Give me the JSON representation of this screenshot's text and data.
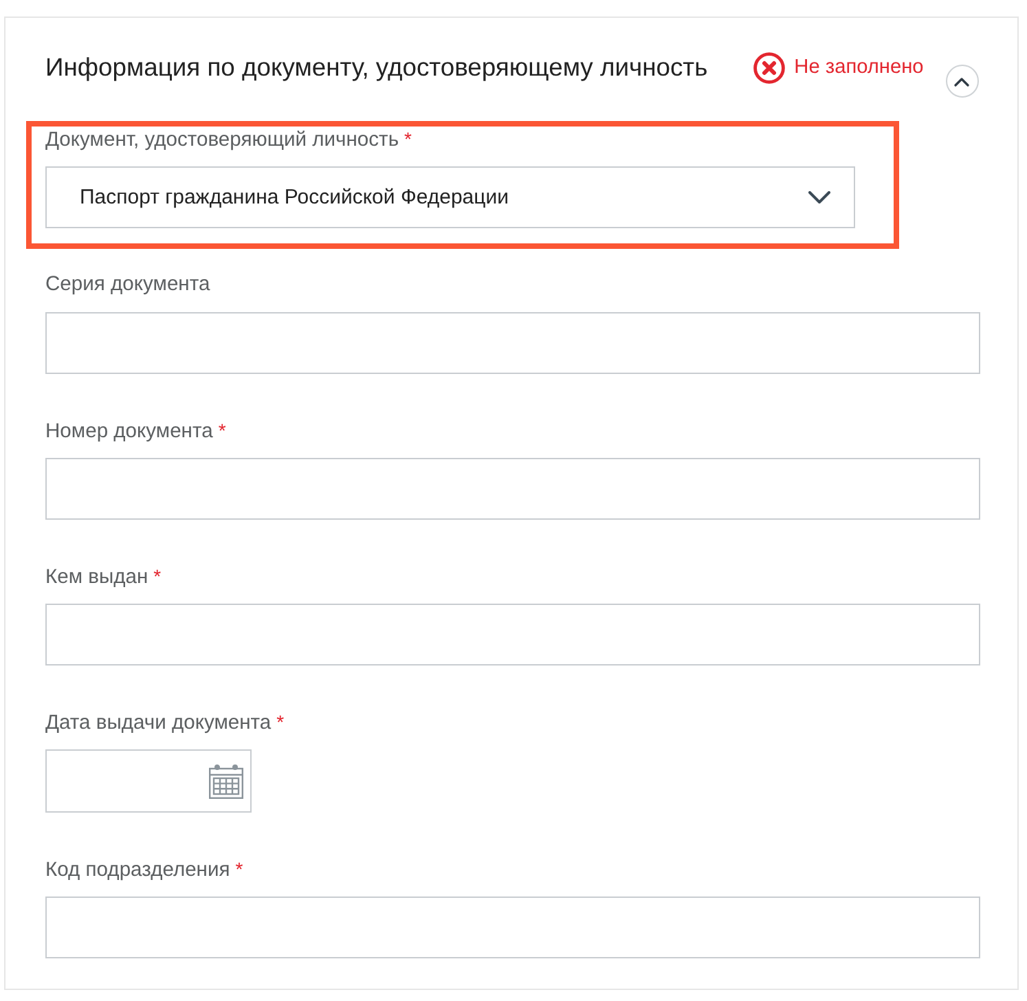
{
  "section": {
    "title": "Информация по документу, удостоверяющему личность",
    "status": {
      "kind": "error",
      "text": "Не заполнено"
    },
    "expanded": true
  },
  "fields": [
    {
      "kind": "select",
      "label": "Документ, удостоверяющий личность",
      "required_mark": "*",
      "value": "Паспорт гражданина Российской Федерации",
      "highlighted": true
    },
    {
      "kind": "text",
      "label": "Серия документа",
      "highlighted": false
    },
    {
      "kind": "text",
      "label": "Номер документа",
      "required_mark": "*",
      "highlighted": false
    },
    {
      "kind": "text",
      "label": "Кем выдан",
      "required_mark": "*",
      "highlighted": false
    },
    {
      "kind": "date",
      "label": "Дата выдачи документа",
      "required_mark": "*",
      "highlighted": false
    },
    {
      "kind": "text",
      "label": "Код подразделения",
      "required_mark": "*",
      "highlighted": false
    }
  ]
}
